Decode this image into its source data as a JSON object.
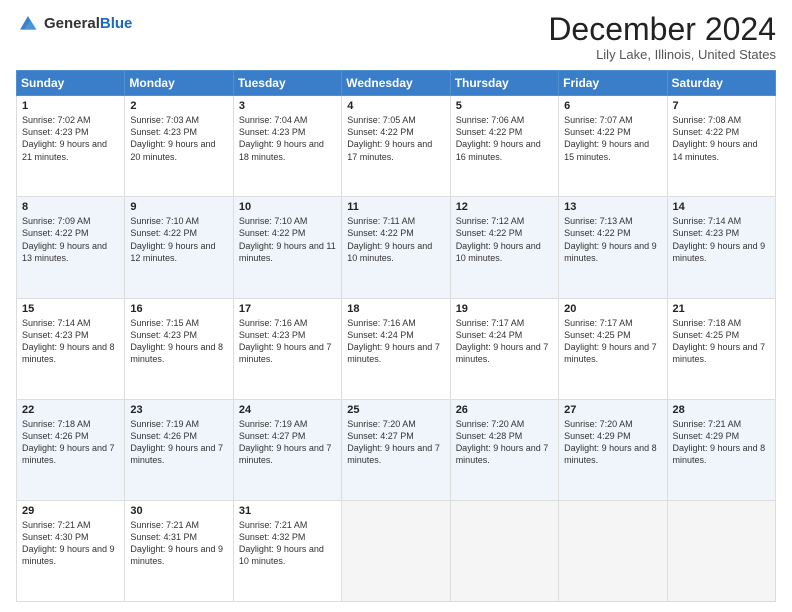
{
  "header": {
    "logo_general": "General",
    "logo_blue": "Blue",
    "month_title": "December 2024",
    "location": "Lily Lake, Illinois, United States"
  },
  "weekdays": [
    "Sunday",
    "Monday",
    "Tuesday",
    "Wednesday",
    "Thursday",
    "Friday",
    "Saturday"
  ],
  "rows": [
    [
      {
        "day": "1",
        "sunrise": "7:02 AM",
        "sunset": "4:23 PM",
        "daylight": "9 hours and 21 minutes."
      },
      {
        "day": "2",
        "sunrise": "7:03 AM",
        "sunset": "4:23 PM",
        "daylight": "9 hours and 20 minutes."
      },
      {
        "day": "3",
        "sunrise": "7:04 AM",
        "sunset": "4:23 PM",
        "daylight": "9 hours and 18 minutes."
      },
      {
        "day": "4",
        "sunrise": "7:05 AM",
        "sunset": "4:22 PM",
        "daylight": "9 hours and 17 minutes."
      },
      {
        "day": "5",
        "sunrise": "7:06 AM",
        "sunset": "4:22 PM",
        "daylight": "9 hours and 16 minutes."
      },
      {
        "day": "6",
        "sunrise": "7:07 AM",
        "sunset": "4:22 PM",
        "daylight": "9 hours and 15 minutes."
      },
      {
        "day": "7",
        "sunrise": "7:08 AM",
        "sunset": "4:22 PM",
        "daylight": "9 hours and 14 minutes."
      }
    ],
    [
      {
        "day": "8",
        "sunrise": "7:09 AM",
        "sunset": "4:22 PM",
        "daylight": "9 hours and 13 minutes."
      },
      {
        "day": "9",
        "sunrise": "7:10 AM",
        "sunset": "4:22 PM",
        "daylight": "9 hours and 12 minutes."
      },
      {
        "day": "10",
        "sunrise": "7:10 AM",
        "sunset": "4:22 PM",
        "daylight": "9 hours and 11 minutes."
      },
      {
        "day": "11",
        "sunrise": "7:11 AM",
        "sunset": "4:22 PM",
        "daylight": "9 hours and 10 minutes."
      },
      {
        "day": "12",
        "sunrise": "7:12 AM",
        "sunset": "4:22 PM",
        "daylight": "9 hours and 10 minutes."
      },
      {
        "day": "13",
        "sunrise": "7:13 AM",
        "sunset": "4:22 PM",
        "daylight": "9 hours and 9 minutes."
      },
      {
        "day": "14",
        "sunrise": "7:14 AM",
        "sunset": "4:23 PM",
        "daylight": "9 hours and 9 minutes."
      }
    ],
    [
      {
        "day": "15",
        "sunrise": "7:14 AM",
        "sunset": "4:23 PM",
        "daylight": "9 hours and 8 minutes."
      },
      {
        "day": "16",
        "sunrise": "7:15 AM",
        "sunset": "4:23 PM",
        "daylight": "9 hours and 8 minutes."
      },
      {
        "day": "17",
        "sunrise": "7:16 AM",
        "sunset": "4:23 PM",
        "daylight": "9 hours and 7 minutes."
      },
      {
        "day": "18",
        "sunrise": "7:16 AM",
        "sunset": "4:24 PM",
        "daylight": "9 hours and 7 minutes."
      },
      {
        "day": "19",
        "sunrise": "7:17 AM",
        "sunset": "4:24 PM",
        "daylight": "9 hours and 7 minutes."
      },
      {
        "day": "20",
        "sunrise": "7:17 AM",
        "sunset": "4:25 PM",
        "daylight": "9 hours and 7 minutes."
      },
      {
        "day": "21",
        "sunrise": "7:18 AM",
        "sunset": "4:25 PM",
        "daylight": "9 hours and 7 minutes."
      }
    ],
    [
      {
        "day": "22",
        "sunrise": "7:18 AM",
        "sunset": "4:26 PM",
        "daylight": "9 hours and 7 minutes."
      },
      {
        "day": "23",
        "sunrise": "7:19 AM",
        "sunset": "4:26 PM",
        "daylight": "9 hours and 7 minutes."
      },
      {
        "day": "24",
        "sunrise": "7:19 AM",
        "sunset": "4:27 PM",
        "daylight": "9 hours and 7 minutes."
      },
      {
        "day": "25",
        "sunrise": "7:20 AM",
        "sunset": "4:27 PM",
        "daylight": "9 hours and 7 minutes."
      },
      {
        "day": "26",
        "sunrise": "7:20 AM",
        "sunset": "4:28 PM",
        "daylight": "9 hours and 7 minutes."
      },
      {
        "day": "27",
        "sunrise": "7:20 AM",
        "sunset": "4:29 PM",
        "daylight": "9 hours and 8 minutes."
      },
      {
        "day": "28",
        "sunrise": "7:21 AM",
        "sunset": "4:29 PM",
        "daylight": "9 hours and 8 minutes."
      }
    ],
    [
      {
        "day": "29",
        "sunrise": "7:21 AM",
        "sunset": "4:30 PM",
        "daylight": "9 hours and 9 minutes."
      },
      {
        "day": "30",
        "sunrise": "7:21 AM",
        "sunset": "4:31 PM",
        "daylight": "9 hours and 9 minutes."
      },
      {
        "day": "31",
        "sunrise": "7:21 AM",
        "sunset": "4:32 PM",
        "daylight": "9 hours and 10 minutes."
      },
      null,
      null,
      null,
      null
    ]
  ],
  "labels": {
    "sunrise": "Sunrise:",
    "sunset": "Sunset:",
    "daylight": "Daylight:"
  }
}
